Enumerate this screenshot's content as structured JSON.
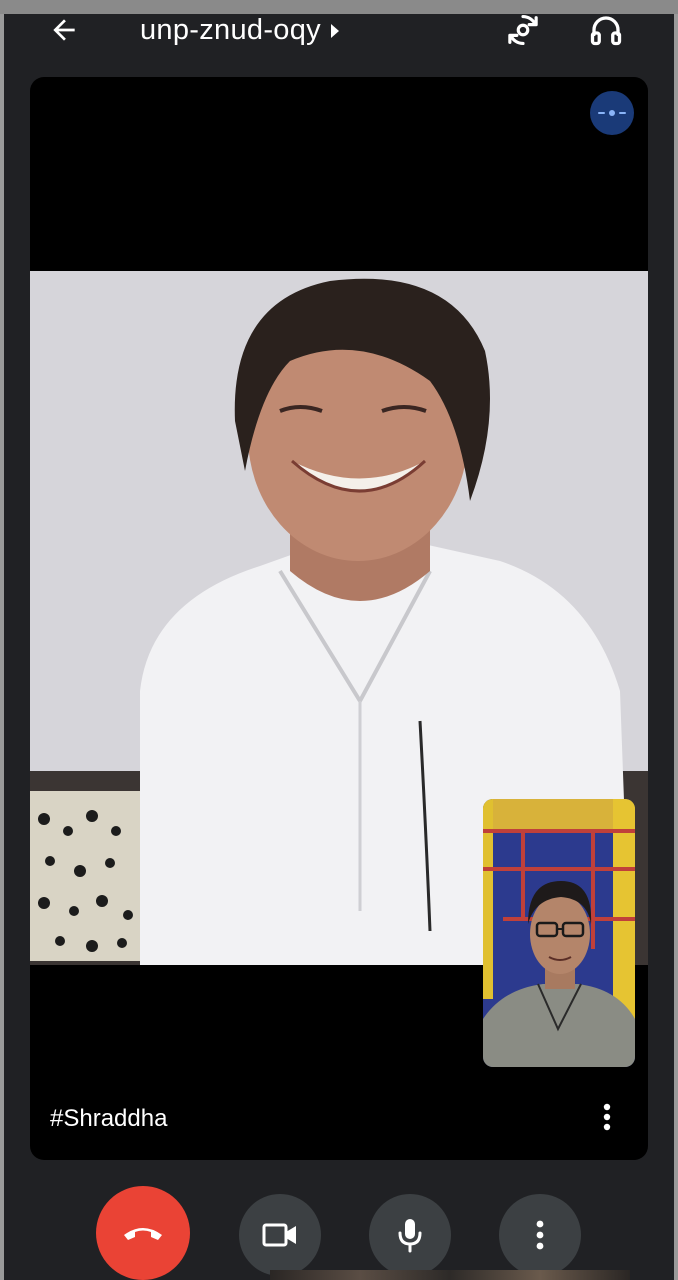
{
  "topbar": {
    "meeting_code": "unp-znud-oqy",
    "back_icon": "arrow-left-icon",
    "switch_camera_icon": "switch-camera-icon",
    "audio_output_icon": "headphones-icon"
  },
  "main_tile": {
    "participant_name": "#Shraddha",
    "audio_indicator_icon": "audio-level-icon",
    "menu_icon": "more-vertical-icon"
  },
  "controls": {
    "end_call_icon": "end-call-icon",
    "camera_icon": "video-camera-icon",
    "mic_icon": "microphone-icon",
    "more_icon": "more-vertical-icon"
  },
  "colors": {
    "background": "#202124",
    "end_call": "#ea4335",
    "control_button": "#3c4043",
    "audio_indicator": "#1a3a78"
  }
}
